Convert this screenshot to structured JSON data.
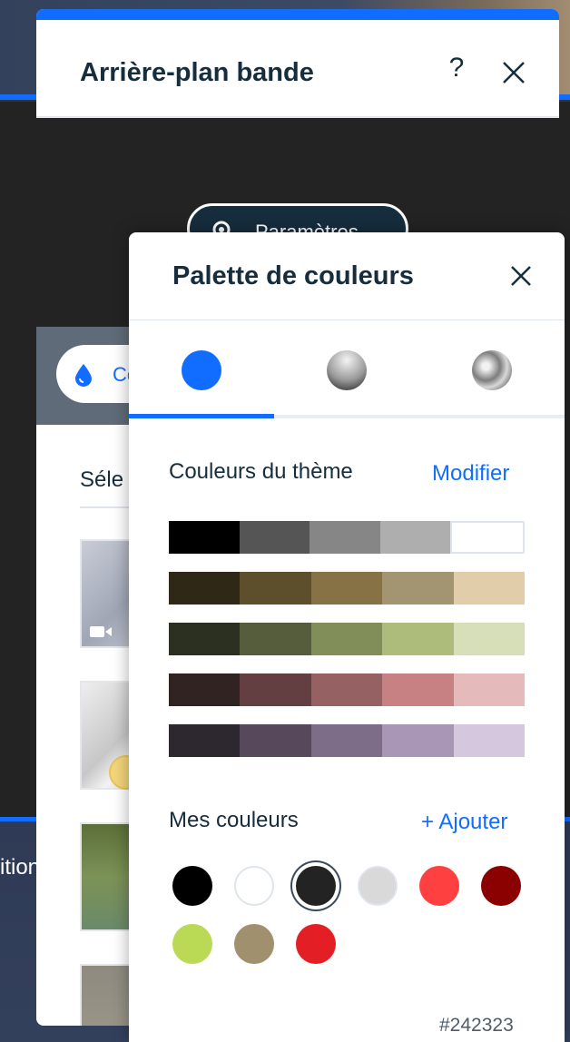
{
  "background": {
    "edition_fragment": "ition"
  },
  "main_panel": {
    "title": "Arrière-plan bande",
    "help_label": "?",
    "settings_button_label": "Paramètres",
    "color_pill_label": "Co",
    "select_label": "Séle"
  },
  "palette": {
    "title": "Palette de couleurs",
    "tabs": [
      {
        "name": "solid-color"
      },
      {
        "name": "gradient"
      },
      {
        "name": "metallic"
      }
    ],
    "theme_colors_label": "Couleurs du thème",
    "modify_label": "Modifier",
    "theme_rows": [
      [
        "#000000",
        "#555555",
        "#868686",
        "#aeaeae",
        "#ffffff"
      ],
      [
        "#2f2817",
        "#5d4e2c",
        "#867245",
        "#a39571",
        "#e1cda9"
      ],
      [
        "#2b3021",
        "#565d3c",
        "#828e5a",
        "#adbc7a",
        "#d7dfb9"
      ],
      [
        "#322323",
        "#633f42",
        "#956162",
        "#c78183",
        "#e5babb"
      ],
      [
        "#2d2730",
        "#57485c",
        "#7e6d88",
        "#a996b6",
        "#d5c7dd"
      ]
    ],
    "my_colors_label": "Mes couleurs",
    "add_label": "+ Ajouter",
    "my_colors": [
      "#000000",
      "#ffffff",
      "#242323",
      "#d9d9d9",
      "#ff4040",
      "#8b0000",
      "#bada55",
      "#a0906e",
      "#e31e24"
    ],
    "selected_index": 2,
    "hex_value": "#242323",
    "accent_color": "#116dff"
  }
}
